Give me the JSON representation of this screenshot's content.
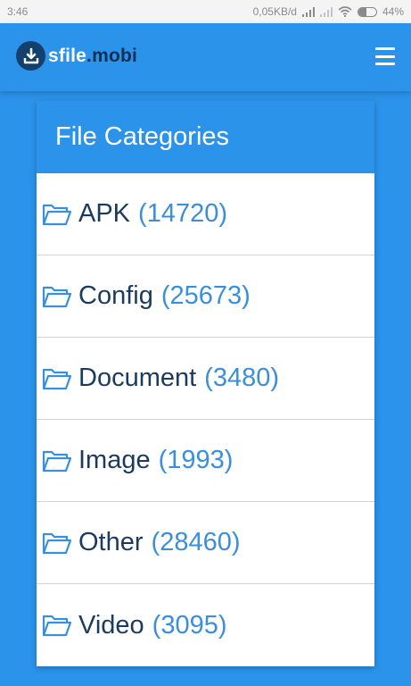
{
  "status_bar": {
    "time": "3:46",
    "network_speed": "0,05KB/d",
    "battery_text": "44%",
    "battery_level": 0.44
  },
  "navbar": {
    "brand_part1": "sfile",
    "brand_part2": ".mobi",
    "menu_icon": "hamburger-menu-icon"
  },
  "card": {
    "title": "File Categories",
    "categories": [
      {
        "name": "APK",
        "count": "(14720)"
      },
      {
        "name": "Config",
        "count": "(25673)"
      },
      {
        "name": "Document",
        "count": "(3480)"
      },
      {
        "name": "Image",
        "count": "(1993)"
      },
      {
        "name": "Other",
        "count": "(28460)"
      },
      {
        "name": "Video",
        "count": "(3095)"
      }
    ]
  },
  "colors": {
    "primary": "#2b93ea",
    "brand_dark": "#14406e",
    "text_dark": "#1b3b5e",
    "count_blue": "#3a8fdc"
  }
}
